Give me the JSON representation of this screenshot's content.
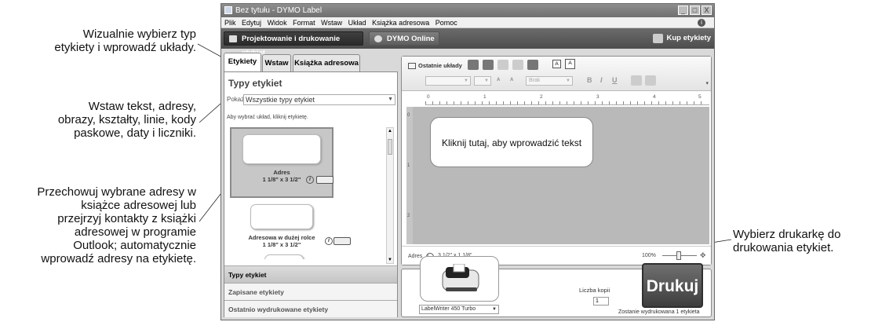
{
  "callouts": {
    "c1": [
      "Wizualnie wybierz typ",
      "etykiety i wprowadź układy."
    ],
    "c2": [
      "Wstaw tekst, adresy,",
      "obrazy, kształty, linie, kody",
      "paskowe, daty i liczniki."
    ],
    "c3": [
      "Przechowuj wybrane adresy w",
      "książce adresowej lub",
      "przejrzyj kontakty z książki",
      "adresowej w programie",
      "Outlook; automatycznie",
      "wprowadź adresy na etykietę."
    ],
    "c4": [
      "Wybierz drukarkę do",
      "drukowania etykiet."
    ]
  },
  "window": {
    "title": "Bez tytułu - DYMO Label",
    "controls": [
      "_",
      "□",
      "X"
    ]
  },
  "menu": [
    "Plik",
    "Edytuj",
    "Widok",
    "Format",
    "Wstaw",
    "Układ",
    "Książka adresowa",
    "Pomoc"
  ],
  "modebar": {
    "design": "Projektowanie i drukowanie etykiet",
    "online": "DYMO Online",
    "buy": "Kup etykiety"
  },
  "tabs": [
    "Etykiety",
    "Wstaw",
    "Książka adresowa"
  ],
  "labels_panel": {
    "title": "Typy etykiet",
    "show_label": "Pokaż",
    "show_value": "Wszystkie typy etykiet",
    "hint": "Aby wybrać układ, kliknij etykietę.",
    "items": [
      {
        "name": "Adres",
        "size": "1 1/8\" x 3 1/2\""
      },
      {
        "name": "Adresowa w dużej rolce",
        "size": "1 1/8\" x 3 1/2\""
      }
    ],
    "sections": [
      "Typy etykiet",
      "Zapisane etykiety",
      "Ostatnio wydrukowane etykiety"
    ]
  },
  "toolbar": {
    "recent_layouts": "Ostatnie układy",
    "font_color": "Brak",
    "bold": "B",
    "italic": "I",
    "underline": "U"
  },
  "ruler": {
    "marks": [
      "0",
      "1",
      "2",
      "3",
      "4",
      "5"
    ],
    "v_marks": [
      "0",
      "1",
      "2"
    ]
  },
  "editor": {
    "placeholder": "Kliknij tutaj, aby wprowadzić tekst"
  },
  "status": {
    "label_name": "Adres",
    "label_size": "3 1/2\" x 1 1/8\"",
    "zoom": "100%"
  },
  "print": {
    "printer": "LabelWriter 450 Turbo",
    "copies_label": "Liczba kopii",
    "copies": "1",
    "button": "Drukuj",
    "will_print": "Zostanie wydrukowana 1 etykieta"
  }
}
